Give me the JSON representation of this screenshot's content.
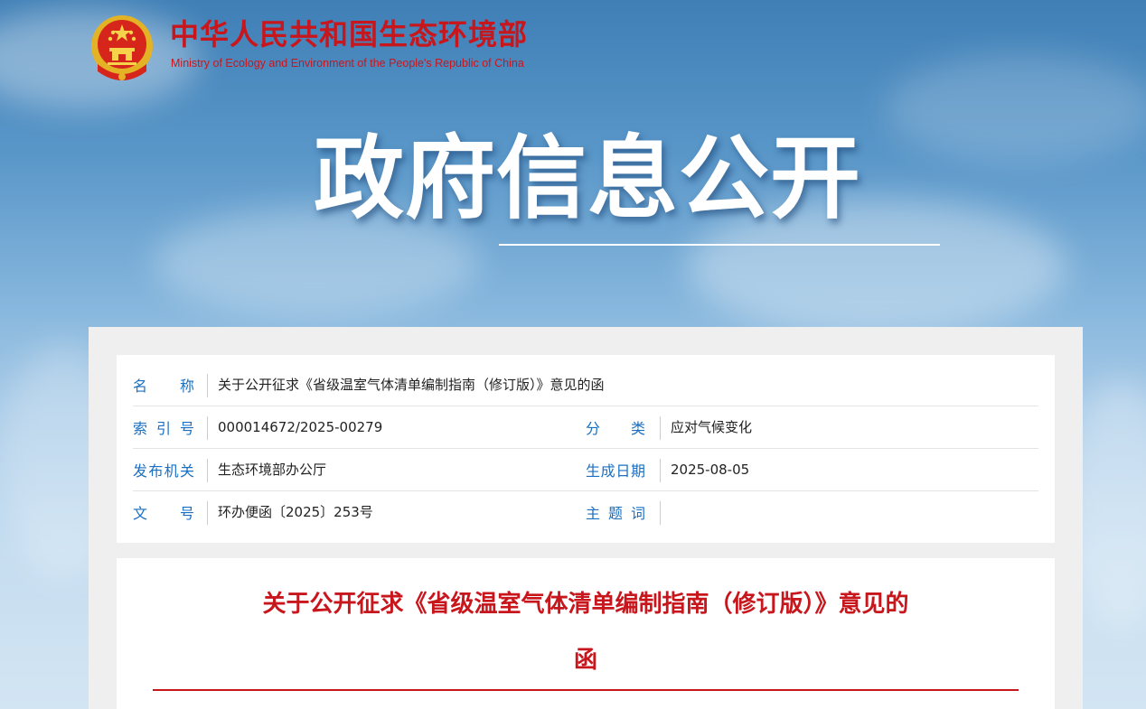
{
  "header": {
    "site_title": "中华人民共和国生态环境部",
    "site_subtitle": "Ministry of Ecology and Environment of the People's Republic of China",
    "emblem_icon": "national-emblem-icon"
  },
  "banner": {
    "title": "政府信息公开"
  },
  "info": {
    "name_label": "名 称",
    "name_value": "关于公开征求《省级温室气体清单编制指南（修订版）》意见的函",
    "index_label": "索 引 号",
    "index_value": "000014672/2025-00279",
    "category_label": "分 类",
    "category_value": "应对气候变化",
    "issuer_label": "发布机关",
    "issuer_value": "生态环境部办公厅",
    "date_label": "生成日期",
    "date_value": "2025-08-05",
    "docno_label": "文 号",
    "docno_value": "环办便函〔2025〕253号",
    "keywords_label": "主 题 词",
    "keywords_value": ""
  },
  "document": {
    "title_line1": "关于公开征求《省级温室气体清单编制指南（修订版）》意见的",
    "title_line2": "函"
  },
  "colors": {
    "brand_red": "#c8161d",
    "label_blue": "#1a6fc0"
  }
}
